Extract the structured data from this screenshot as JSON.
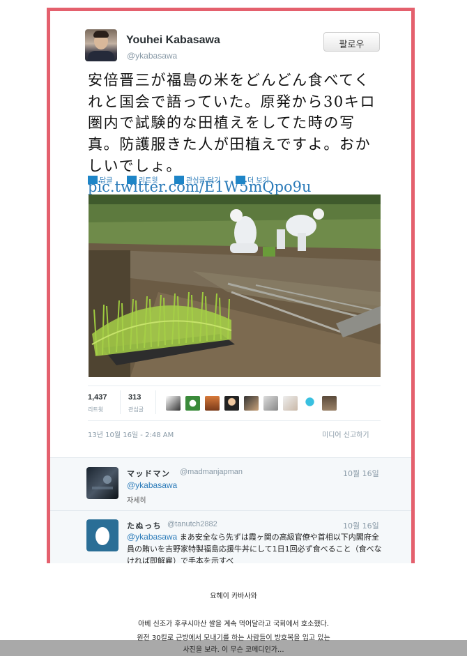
{
  "tweet": {
    "user_name": "Youhei Kabasawa",
    "user_handle": "@ykabasawa",
    "follow_label": "팔로우",
    "text": "安倍晋三が福島の米をどんどん食べてくれと国会で語っていた。原発から30キロ圏内で試験的な田植えをしてた時の写真。防護服きた人が田植えですよ。おかしいでしょ。",
    "link": "pic.twitter.com/E1W5mQpo9u",
    "actions": [
      "답글",
      "리트윗",
      "관심글 담기",
      "더 보기"
    ],
    "retweets_count": "1,437",
    "retweets_label": "리트윗",
    "favorites_count": "313",
    "favorites_label": "관심글",
    "timestamp": "13년 10월 16일 - 2:48 AM",
    "report_label": "미디어 신고하기",
    "photo_icon": "rice-paddy-photo"
  },
  "replies": [
    {
      "name": "マッドマン",
      "handle": "@madmanjapman",
      "date": "10월 16일",
      "mention": "@ykabasawa",
      "text": "",
      "more_label": "자세히"
    },
    {
      "name": "たぬっち",
      "handle": "@tanutch2882",
      "date": "10월 16일",
      "mention": "@ykabasawa",
      "text": "まあ安全なら先ずは霞ヶ関の高級官僚や首相以下内閣府全員の賄いを吉野家特製福島応援牛丼にして1日1回必ず食べること（食べなければ即解雇）で手本を示すべ"
    }
  ],
  "caption": {
    "title": "요헤이 카바사와",
    "lines": [
      "아베 신조가 후쿠시마산 쌀을 계속 먹어달라고 국회에서 호소했다.",
      "원전 30킬로 근방에서 모내기를 하는 사람들이 방호복을 입고 있는",
      "사진을 보라. 이 무슨 코메디인가..."
    ]
  },
  "colors": {
    "frame_border": "#e4606d",
    "link": "#2b7bb9",
    "action_icon": "#1e85c7"
  }
}
